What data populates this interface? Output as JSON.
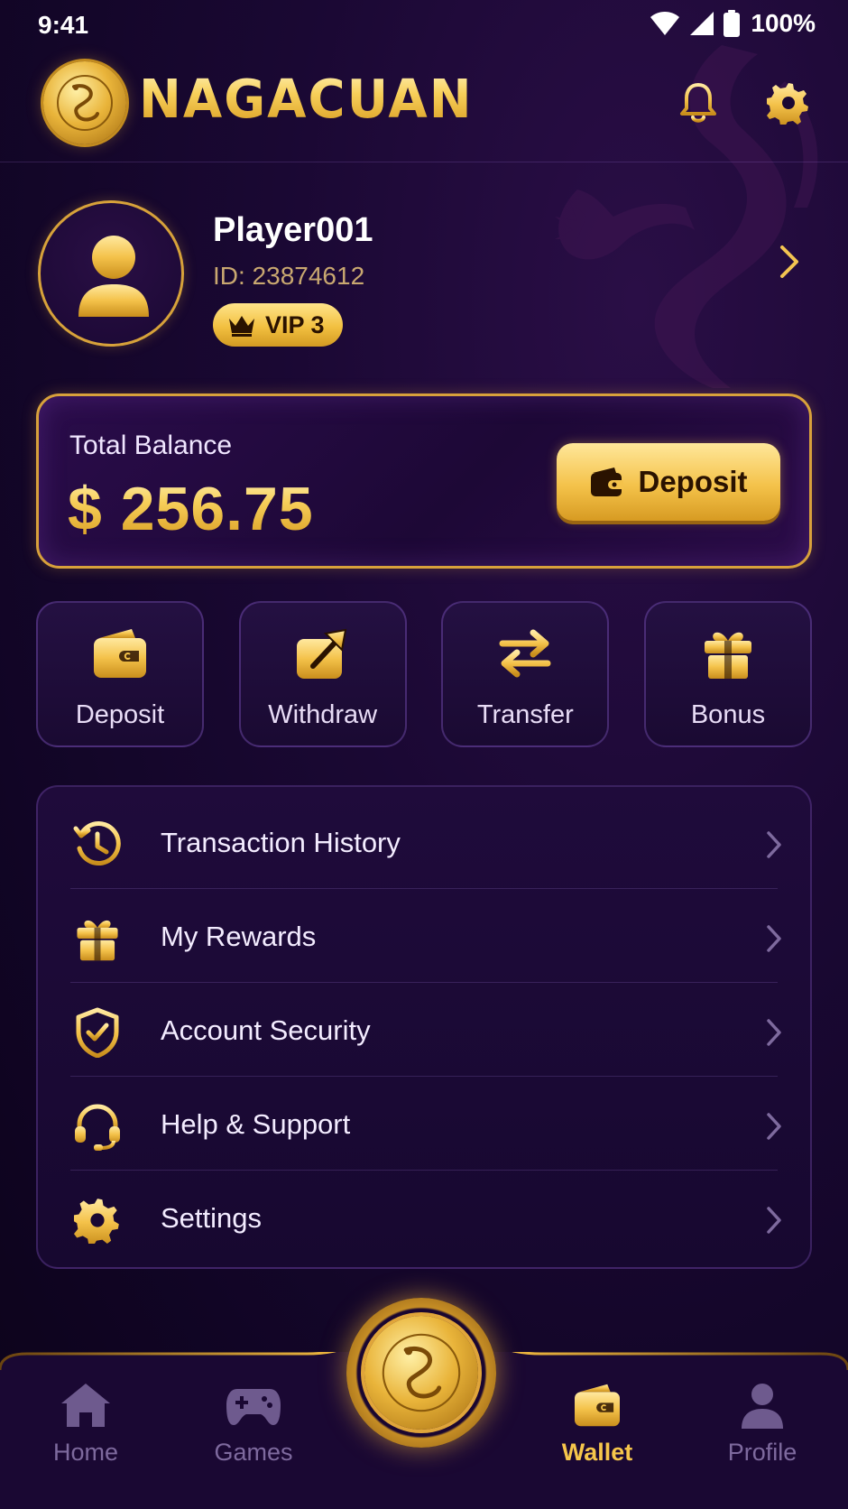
{
  "status_bar": {
    "time": "9:41",
    "battery": "100%"
  },
  "header": {
    "brand": "NAGACUAN",
    "notification_icon": "bell-icon",
    "settings_icon": "gear-icon"
  },
  "profile": {
    "name": "Player001",
    "id": "ID: 23874612",
    "vip": "VIP 3"
  },
  "balance": {
    "label": "Total Balance",
    "amount": "$ 256.75",
    "deposit_label": "Deposit"
  },
  "quick_actions": [
    {
      "label": "Deposit",
      "icon": "wallet-icon"
    },
    {
      "label": "Withdraw",
      "icon": "withdraw-icon"
    },
    {
      "label": "Transfer",
      "icon": "transfer-icon"
    },
    {
      "label": "Bonus",
      "icon": "gift-icon"
    }
  ],
  "menu": [
    {
      "label": "Transaction History",
      "icon": "history-icon"
    },
    {
      "label": "My Rewards",
      "icon": "gift-icon"
    },
    {
      "label": "Account Security",
      "icon": "shield-icon"
    },
    {
      "label": "Help & Support",
      "icon": "headset-icon"
    },
    {
      "label": "Settings",
      "icon": "gear-icon"
    }
  ],
  "bottom_nav": [
    {
      "label": "Home",
      "icon": "home-icon"
    },
    {
      "label": "Games",
      "icon": "gamepad-icon"
    },
    {
      "label": "Wallet",
      "icon": "wallet-icon",
      "active": true
    },
    {
      "label": "Profile",
      "icon": "person-icon"
    }
  ],
  "colors": {
    "accent_gold": "#f6c64b",
    "background": "#140628",
    "inactive_nav": "#7e6a9e"
  }
}
